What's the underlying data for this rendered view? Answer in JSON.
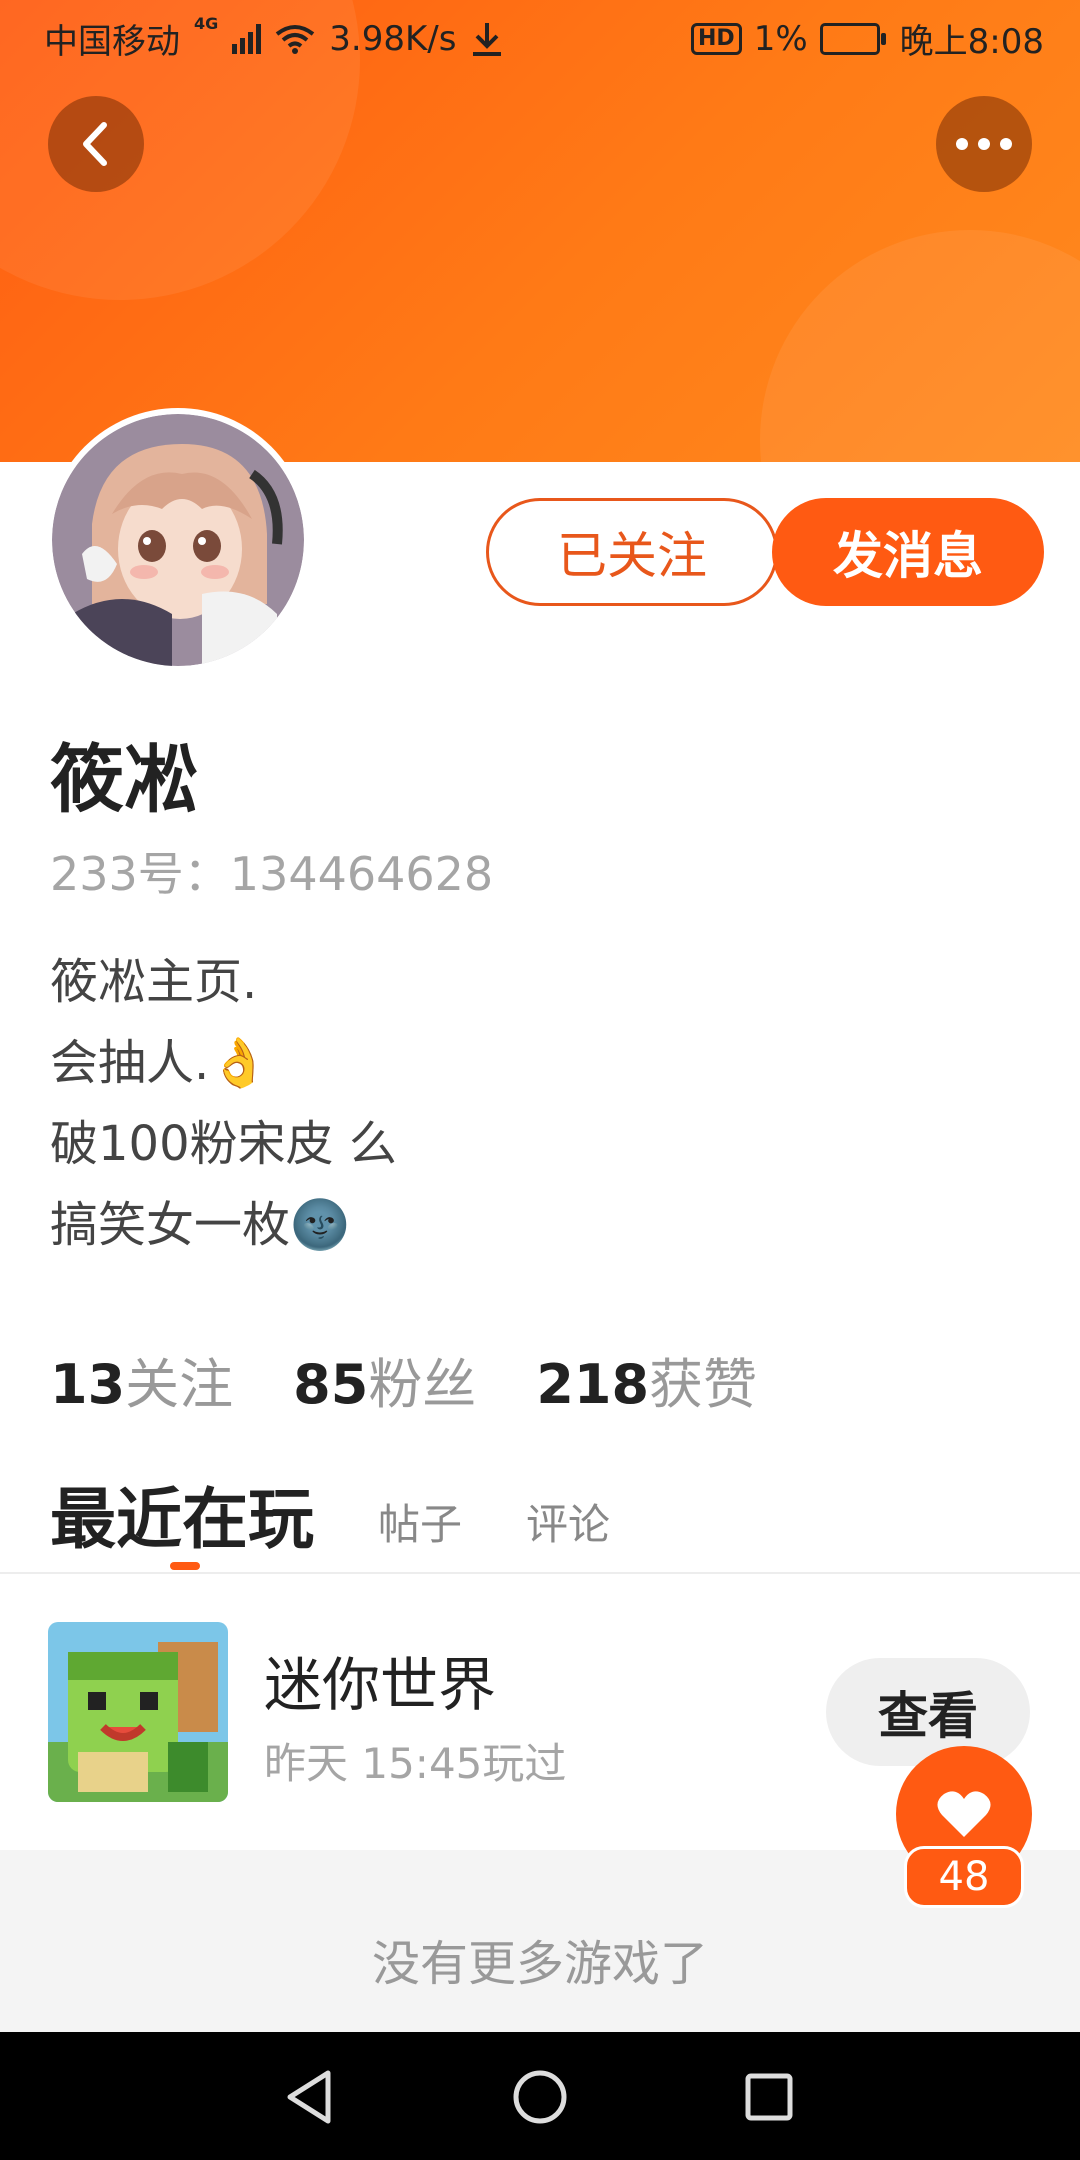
{
  "status_bar": {
    "carrier": "中国移动",
    "network": "4G",
    "speed": "3.98K/s",
    "hd": "HD",
    "battery": "1%",
    "time": "晚上8:08"
  },
  "header": {
    "back_icon": "chevron-left-icon",
    "more_icon": "more-dots-icon",
    "gradient_colors": [
      "#ff5c12",
      "#ff8a1e"
    ]
  },
  "profile": {
    "following_button": "已关注",
    "message_button": "发消息",
    "name": "筱凇",
    "uid": "233号：134464628",
    "bio": [
      {
        "text": "筱凇主页."
      },
      {
        "text": "会抽人.",
        "emoji": "👌"
      },
      {
        "text": "破100粉宋皮 么"
      },
      {
        "text": "搞笑女一枚",
        "emoji": "🌚"
      }
    ]
  },
  "stats": [
    {
      "num": "13",
      "label": "关注"
    },
    {
      "num": "85",
      "label": "粉丝"
    },
    {
      "num": "218",
      "label": "获赞"
    }
  ],
  "tabs": {
    "active": "最近在玩",
    "others": [
      "帖子",
      "评论"
    ]
  },
  "game": {
    "title": "迷你世界",
    "played": "昨天 15:45玩过",
    "view_button": "查看"
  },
  "footer_text": "没有更多游戏了",
  "like": {
    "icon": "heart-icon",
    "count": "48"
  },
  "accent_color": "#ff5a12"
}
